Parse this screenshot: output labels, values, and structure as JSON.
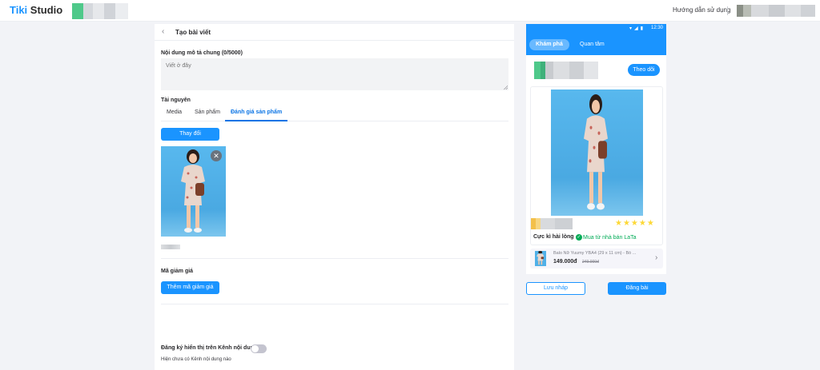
{
  "topbar": {
    "brand_tiki": "Tiki",
    "brand_studio": " Studio",
    "help_link": "Hướng dẫn sử dụng"
  },
  "main": {
    "title": "Tạo bài viết",
    "desc_label_prefix": "Nội dung mô tả chung (",
    "desc_count": "0",
    "desc_label_suffix": "/5000)",
    "desc_placeholder": "Viết ở đây",
    "desc_value": "",
    "resources_label": "Tài nguyên",
    "tabs": [
      {
        "label": "Media"
      },
      {
        "label": "Sản phẩm"
      },
      {
        "label": "Đánh giá sản phẩm"
      }
    ],
    "change_button": "Thay đổi",
    "coupon_label": "Mã giảm giá",
    "add_coupon_button": "Thêm mã giảm giá",
    "register_label": "Đăng ký hiển thị trên Kênh nội dung",
    "register_enabled": false,
    "register_hint": "Hiện chưa có Kênh nội dung nào"
  },
  "phone": {
    "time": "12:30",
    "tabs": [
      {
        "label": "Khám phá"
      },
      {
        "label": "Quan tâm"
      }
    ],
    "follow_button": "Theo dõi",
    "stars": "★★★★★",
    "rating_text": "Cực kì hài lòng",
    "verified_text": "Mua từ nhà bán LaTa",
    "product_name": "Balo Nữ Yuumy YBA4 (29 x 11 cm) - Bò ...",
    "product_price": "149.000đ",
    "product_old_price": "249.000đ"
  },
  "actions": {
    "save_draft": "Lưu nháp",
    "publish": "Đăng bài"
  },
  "colors": {
    "primary": "#1a94ff",
    "success": "#00ab56",
    "star": "#fdd836"
  },
  "icons": [
    "chevron-left-icon",
    "close-icon",
    "check-circle-icon",
    "chevron-right-icon",
    "wifi-icon",
    "signal-icon",
    "battery-icon",
    "star-icon"
  ]
}
